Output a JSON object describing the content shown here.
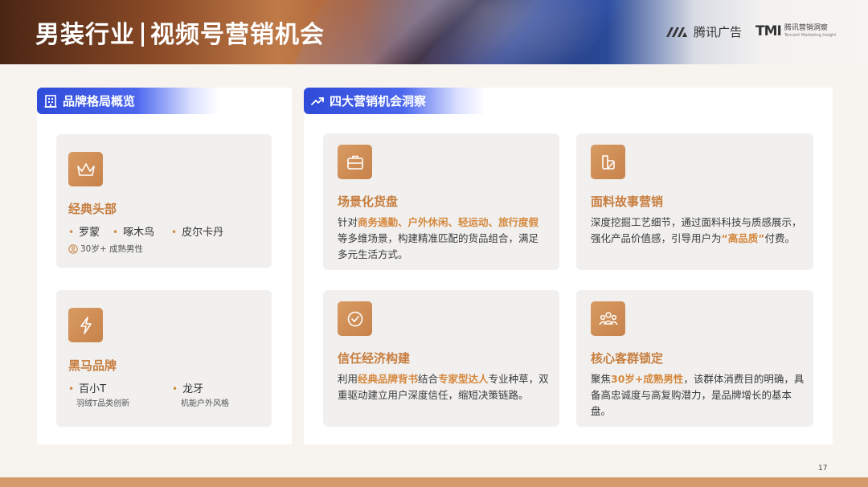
{
  "header": {
    "title_part1": "男装行业",
    "title_part2": "视频号营销机会",
    "logo1_text": "腾讯广告",
    "logo2_mark": "TMI",
    "logo2_cn": "腾讯营销洞察",
    "logo2_en": "Tencent Marketing Insight"
  },
  "left_section": {
    "label": "品牌格局概览",
    "cards": [
      {
        "title": "经典头部",
        "icon": "crown-icon",
        "brands": [
          "罗蒙",
          "啄木鸟",
          "皮尔卡丹"
        ],
        "audience": "30岁+ 成熟男性"
      },
      {
        "title": "黑马品牌",
        "icon": "lightning-icon",
        "brands": [
          {
            "name": "百小T",
            "note": "羽绒T品类创新"
          },
          {
            "name": "龙牙",
            "note": "机能户外风格"
          }
        ]
      }
    ]
  },
  "right_section": {
    "label": "四大营销机会洞察",
    "cards": [
      {
        "title": "场景化货盘",
        "icon": "briefcase-icon",
        "body_pre": "针对",
        "body_hl": "商务通勤、户外休闲、轻运动、旅行度假",
        "body_post": "等多维场景，构建精准匹配的货品组合，满足多元生活方式。"
      },
      {
        "title": "面料故事营销",
        "icon": "fabric-icon",
        "body_pre": "深度挖掘工艺细节，通过面料科技与质感展示，强化产品价值感，引导用户为",
        "body_hl": "“高品质”",
        "body_post": "付费。"
      },
      {
        "title": "信任经济构建",
        "icon": "check-badge-icon",
        "body_pre": "利用",
        "body_hl": "经典品牌背书",
        "body_mid": "结合",
        "body_hl2": "专家型达人",
        "body_post": "专业种草，双重驱动建立用户深度信任，缩短决策链路。"
      },
      {
        "title": "核心客群锁定",
        "icon": "users-icon",
        "body_pre": "聚焦",
        "body_hl": "30岁+成熟男性",
        "body_post": "，该群体消费目的明确，具备高忠诚度与高复购潜力，是品牌增长的基本盘。"
      }
    ]
  },
  "page_number": "17",
  "colors": {
    "accent_orange": "#d5883e",
    "tag_blue": "#2e4bd9",
    "bottom_bar": "#d49a6a"
  }
}
